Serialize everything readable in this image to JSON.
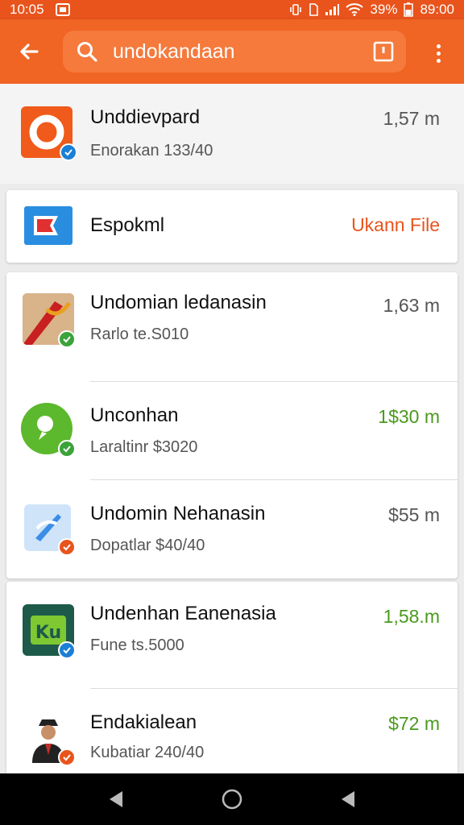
{
  "status_bar": {
    "time": "10:05",
    "battery": "39%",
    "clock_right": "89:00"
  },
  "toolbar": {
    "search_value": "undokandaan",
    "icons": {
      "back": "back-arrow-icon",
      "search": "search-icon",
      "box": "square-icon",
      "more": "more-vertical-icon"
    }
  },
  "top_item": {
    "title": "Unddievpard",
    "subtitle": "Enorakan 133/40",
    "amount": "1,57 m",
    "badge_color": "#1a7fd6"
  },
  "highlight_item": {
    "title": "Espokml",
    "action": "Ukann File"
  },
  "list": [
    {
      "title": "Undomian ledanasin",
      "subtitle": "Rarlo te.S010",
      "amount": "1,63 m",
      "amount_color": "gray",
      "badge": "check-icon",
      "badge_color": "#3aa33a"
    },
    {
      "title": "Unconhan",
      "subtitle": "Laraltinr $3020",
      "amount": "1$30 m",
      "amount_color": "green",
      "badge": "check-icon",
      "badge_color": "#3aa33a"
    },
    {
      "title": "Undomin Nehanasin",
      "subtitle": "Dopatlar $40/40",
      "amount": "$55 m",
      "amount_color": "gray",
      "badge": "check-icon",
      "badge_color": "#e8541c"
    },
    {
      "title": "Undenhan Eanenasia",
      "subtitle": "Fune ts.5000",
      "amount": "1,58.m",
      "amount_color": "green",
      "badge": "verified-icon",
      "badge_color": "#1a7fd6"
    },
    {
      "title": "Endakialean",
      "subtitle": "Kubatiar 240/40",
      "amount": "$72 m",
      "amount_color": "green",
      "badge": "check-icon",
      "badge_color": "#e8541c"
    }
  ],
  "nav_bar": {
    "icons": [
      "back-triangle-icon",
      "home-circle-icon",
      "recents-triangle-icon"
    ]
  }
}
